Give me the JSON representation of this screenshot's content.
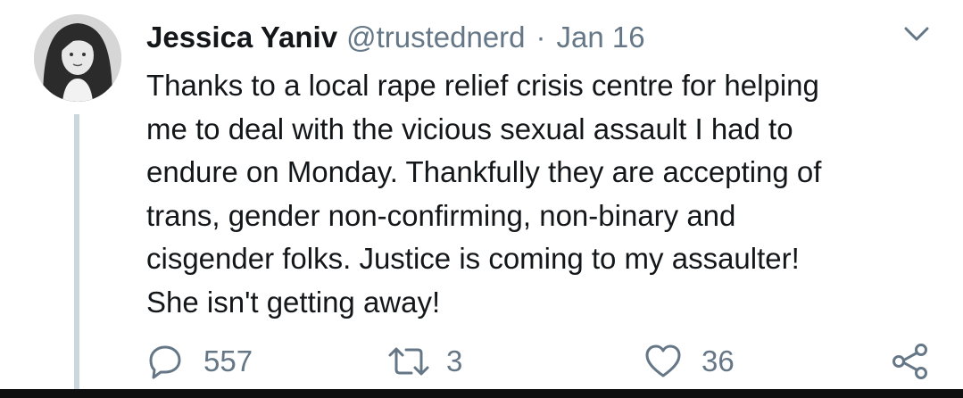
{
  "tweet": {
    "author": {
      "name": "Jessica Yaniv",
      "handle": "@trustednerd",
      "avatar_icon": "user-avatar"
    },
    "separator": "·",
    "date": "Jan 16",
    "menu_icon": "chevron-down-icon",
    "text_lines": [
      "Thanks to a local rape relief crisis centre for helping",
      "me to deal with the vicious sexual assault I had to",
      "endure on Monday. Thankfully they are accepting of",
      "trans, gender non-confirming, non-binary and",
      "cisgender folks. Justice is coming to my assaulter!",
      "She isn't getting away!"
    ],
    "actions": {
      "reply": {
        "icon": "reply-icon",
        "count": "557"
      },
      "retweet": {
        "icon": "retweet-icon",
        "count": "3"
      },
      "like": {
        "icon": "heart-icon",
        "count": "36"
      },
      "share": {
        "icon": "share-icon"
      }
    }
  },
  "colors": {
    "text": "#14171a",
    "secondary": "#657786",
    "thread_line": "#ccd6dd",
    "background": "#ffffff"
  }
}
